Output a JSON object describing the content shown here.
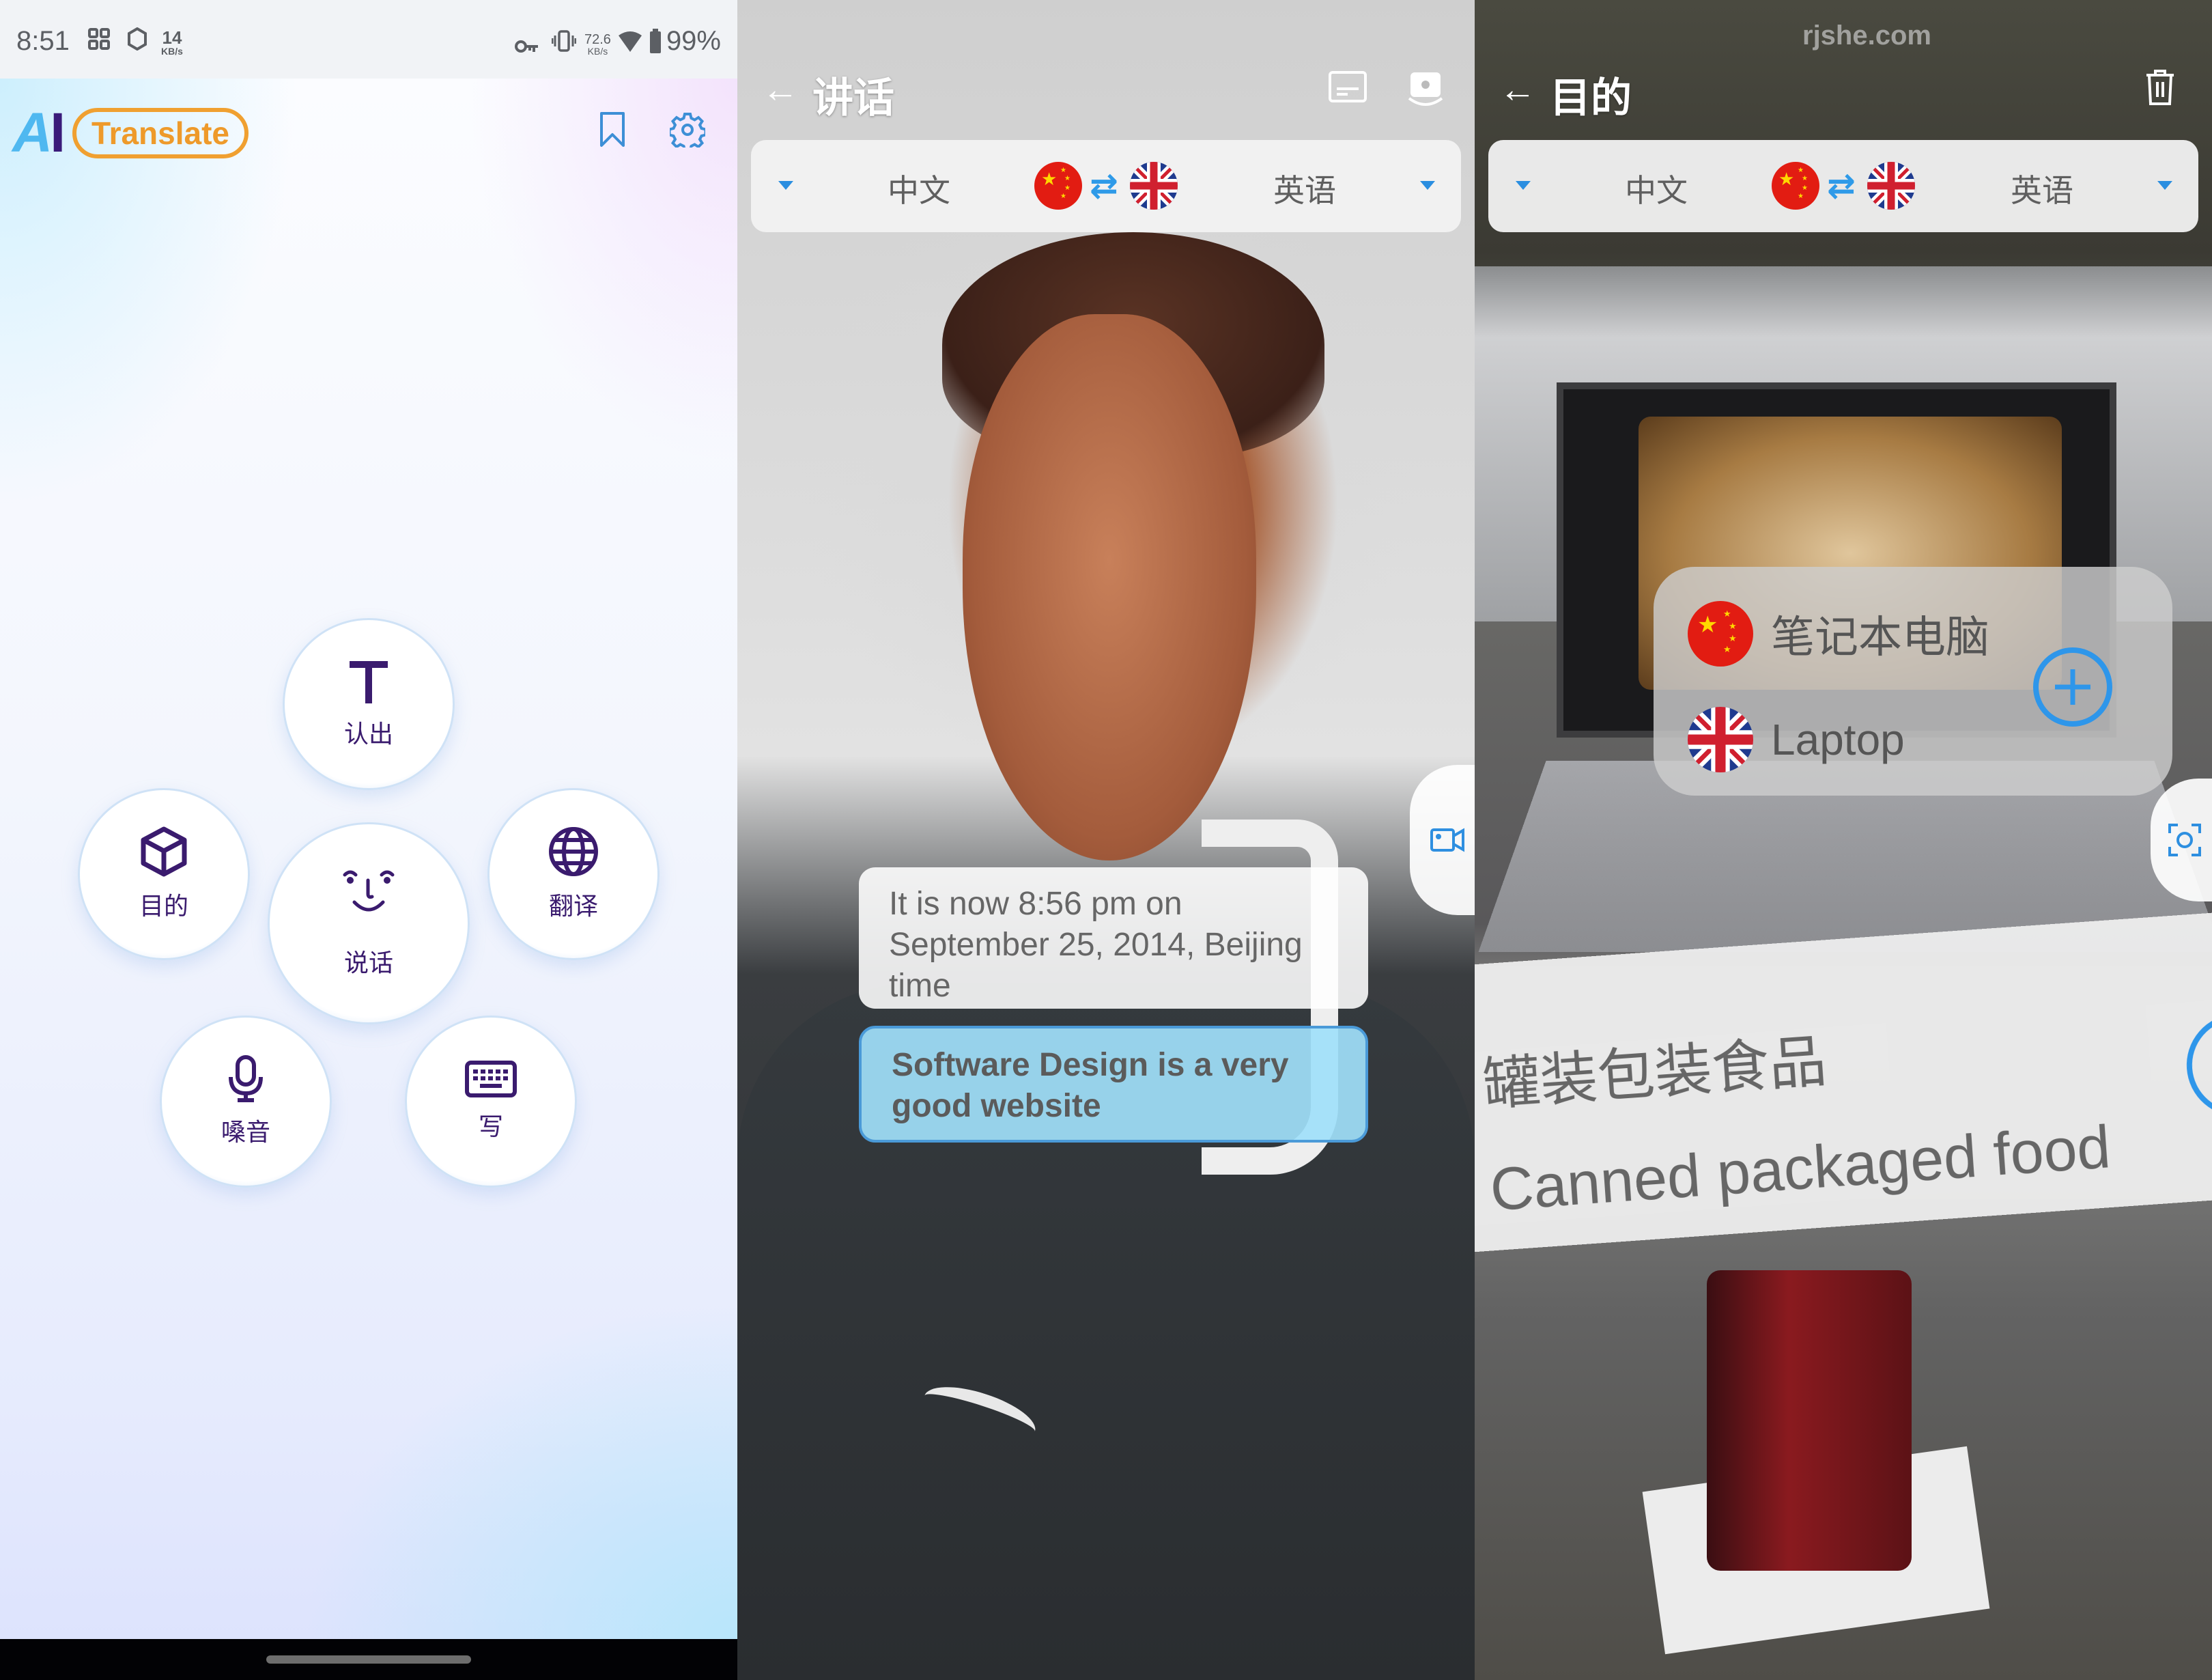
{
  "panel_home": {
    "status_bar": {
      "time": "8:51",
      "net_speed_left": "14",
      "net_speed_left_unit": "KB/s",
      "net_speed_right": "72.6",
      "net_speed_right_unit": "KB/s",
      "battery": "99%"
    },
    "logo": {
      "ai": "AI",
      "pill": "Translate"
    },
    "header_icons": [
      "bookmark-icon",
      "settings-icon"
    ],
    "features": [
      {
        "id": "recognize",
        "label": "认出",
        "icon": "text-T-icon"
      },
      {
        "id": "object",
        "label": "目的",
        "icon": "cube-icon"
      },
      {
        "id": "talk",
        "label": "说话",
        "icon": "face-icon"
      },
      {
        "id": "translate",
        "label": "翻译",
        "icon": "globe-icon"
      },
      {
        "id": "voice",
        "label": "嗓音",
        "icon": "microphone-icon"
      },
      {
        "id": "write",
        "label": "写",
        "icon": "keyboard-icon"
      }
    ]
  },
  "panel_talk": {
    "title": "讲话",
    "source_lang": "中文",
    "target_lang": "英语",
    "source_text": "It is now 8:56 pm on September 25, 2014, Beijing time",
    "translated_text": "Software Design is a very good website",
    "header_icons": [
      "subtitles-icon",
      "switch-camera-icon"
    ],
    "side_button": "video-camera-icon"
  },
  "panel_object": {
    "title": "目的",
    "watermark": "rjshe.com",
    "source_lang": "中文",
    "target_lang": "英语",
    "detections": [
      {
        "source": "笔记本电脑",
        "target": "Laptop"
      },
      {
        "source": "罐装包装食品",
        "target": "Canned packaged food"
      }
    ],
    "header_icons": [
      "trash-icon"
    ],
    "side_button": "scan-icon"
  },
  "colors": {
    "accent_blue": "#2e96ea",
    "icon_purple": "#3a1b6e",
    "logo_orange": "#ee9a2a"
  }
}
